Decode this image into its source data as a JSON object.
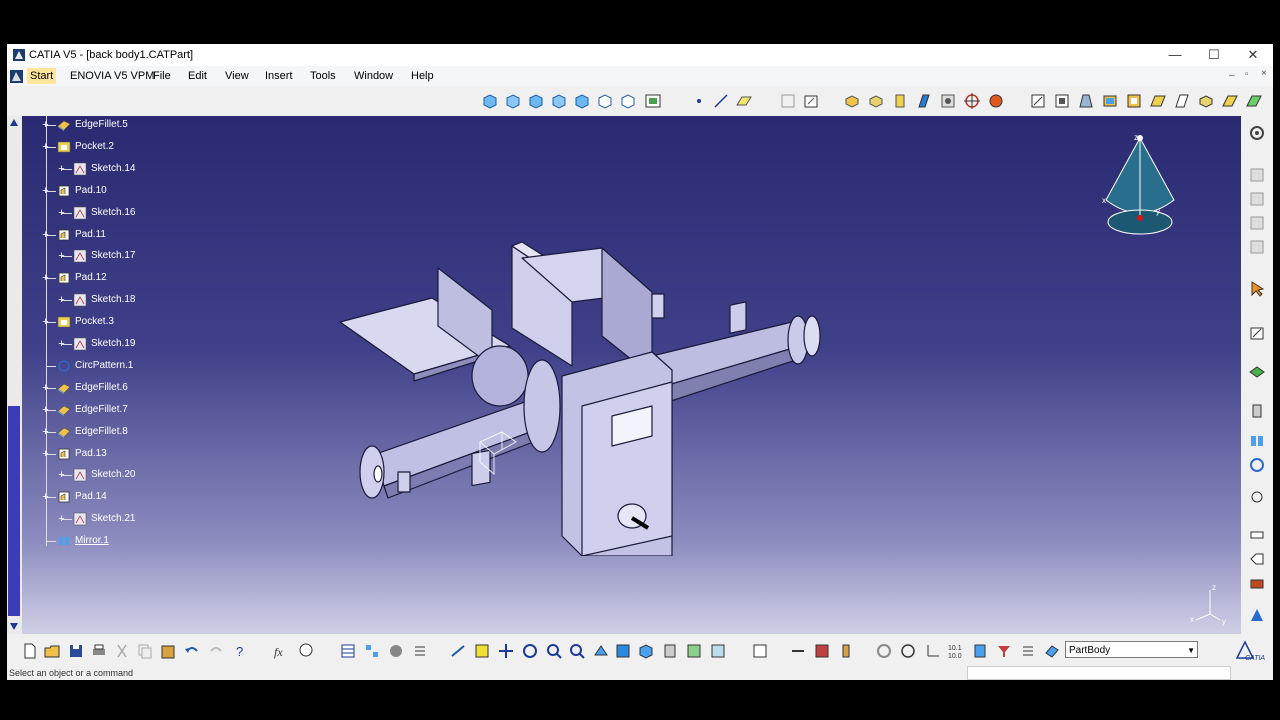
{
  "window": {
    "title": "CATIA V5 - [back body1.CATPart]",
    "controls": {
      "minimize": "—",
      "maximize": "☐",
      "close": "✕"
    }
  },
  "menubar": {
    "items": [
      "Start",
      "ENOVIA V5 VPM",
      "File",
      "Edit",
      "View",
      "Insert",
      "Tools",
      "Window",
      "Help"
    ],
    "mdi_controls": {
      "minimize": "–",
      "restore": "▫",
      "close": "×"
    }
  },
  "tree": {
    "items": [
      {
        "label": "EdgeFillet.5",
        "icon": "edge-fillet-icon",
        "level": 0
      },
      {
        "label": "Pocket.2",
        "icon": "pocket-icon",
        "level": 0
      },
      {
        "label": "Sketch.14",
        "icon": "sketch-icon",
        "level": 1
      },
      {
        "label": "Pad.10",
        "icon": "pad-icon",
        "level": 0
      },
      {
        "label": "Sketch.16",
        "icon": "sketch-icon",
        "level": 1
      },
      {
        "label": "Pad.11",
        "icon": "pad-icon",
        "level": 0
      },
      {
        "label": "Sketch.17",
        "icon": "sketch-icon",
        "level": 1
      },
      {
        "label": "Pad.12",
        "icon": "pad-icon",
        "level": 0
      },
      {
        "label": "Sketch.18",
        "icon": "sketch-icon",
        "level": 1
      },
      {
        "label": "Pocket.3",
        "icon": "pocket-icon",
        "level": 0
      },
      {
        "label": "Sketch.19",
        "icon": "sketch-icon",
        "level": 1
      },
      {
        "label": "CircPattern.1",
        "icon": "circpattern-icon",
        "level": 0
      },
      {
        "label": "EdgeFillet.6",
        "icon": "edge-fillet-icon",
        "level": 0
      },
      {
        "label": "EdgeFillet.7",
        "icon": "edge-fillet-icon",
        "level": 0
      },
      {
        "label": "EdgeFillet.8",
        "icon": "edge-fillet-icon",
        "level": 0
      },
      {
        "label": "Pad.13",
        "icon": "pad-icon",
        "level": 0
      },
      {
        "label": "Sketch.20",
        "icon": "sketch-icon",
        "level": 1
      },
      {
        "label": "Pad.14",
        "icon": "pad-icon",
        "level": 0
      },
      {
        "label": "Sketch.21",
        "icon": "sketch-icon",
        "level": 1
      },
      {
        "label": "Mirror.1",
        "icon": "mirror-icon",
        "level": 0
      }
    ]
  },
  "compass": {
    "x_label": "x",
    "y_label": "y",
    "z_label": "z"
  },
  "axis_triad": {
    "x_label": "x",
    "y_label": "y",
    "z_label": "z"
  },
  "toolbar": {
    "body_select": "PartBody"
  },
  "status": {
    "message": "Select an object or a command"
  },
  "brand": {
    "logo_text": "CATIA"
  },
  "colors": {
    "viewport_top": "#2a2a72",
    "viewport_bottom": "#cfcfe6",
    "part_face": "#c9c9e8",
    "tree_text": "#ffffff"
  }
}
